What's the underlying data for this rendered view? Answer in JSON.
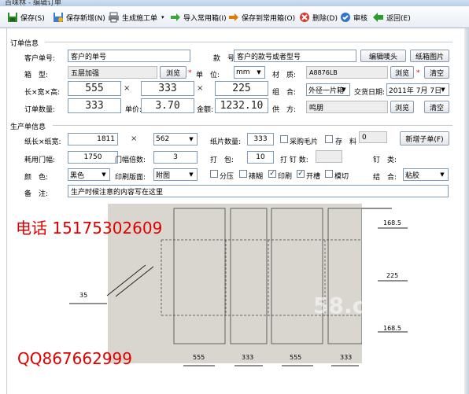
{
  "window": {
    "title": "百味林 - 编辑订单"
  },
  "toolbar": {
    "save": "保存(S)",
    "save_new": "保存新增(N)",
    "gen_work": "生成施工单",
    "import": "导入常用箱(I)",
    "save_common": "保存到常用箱(O)",
    "delete": "删除(D)",
    "audit": "审核",
    "back": "返回(E)"
  },
  "order": {
    "section": "订单信息",
    "cust_no_label": "客户单号:",
    "cust_no_value": "客户的单号",
    "style_label": "款　号:",
    "style_value": "客户的款号或者型号",
    "edit_head_btn": "编辑唛头",
    "carton_img_btn": "纸箱图片",
    "box_label": "箱　型:",
    "box_value": "五层加强",
    "browse1": "浏览",
    "unit_label": "单　位:",
    "unit_value": "mm",
    "material_label": "材　质:",
    "material_value": "A8876LB",
    "browse2": "浏览",
    "clear1": "清空",
    "dims_label": "长×宽×高:",
    "length": "555",
    "width": "333",
    "height": "225",
    "times": "×",
    "combo_label": "组　合:",
    "combo_value": "外径一片箱",
    "delivery_label": "交货日期:",
    "delivery_value": "2011年 7月 7日",
    "qty_label": "订单数量:",
    "qty_value": "333",
    "price_label": "单价:",
    "price_value": "3.70",
    "amount_label": "金额:",
    "amount_value": "1232.10",
    "supplier_label": "供　方:",
    "supplier_value": "鸣朋",
    "browse3": "浏览",
    "clear2": "清空",
    "star": "*"
  },
  "production": {
    "section": "生产单信息",
    "paper_label": "纸长×纸宽:",
    "paper_len": "1811",
    "paper_wid": "562",
    "sheets_label": "纸片数量:",
    "sheets_value": "333",
    "purchase_label": "采购毛片",
    "stock_label": "存　料",
    "stock_value": "0",
    "new_job_btn": "新增子单(F)",
    "door_label": "耗用门幅:",
    "door_value": "1750",
    "door_mult_label": "门幅倍数:",
    "door_mult_value": "3",
    "pack_label": "打　包:",
    "pack_value": "10",
    "nail_count_label": "打 钉 数:",
    "nail_label": "钉　类:",
    "color_label": "颜　色:",
    "color_value": "黑色",
    "print_label": "印刷版面:",
    "print_value": "附图",
    "opt_split": "分压",
    "opt_glue": "裱糊",
    "opt_print": "印刷",
    "opt_slot": "开槽",
    "opt_die": "模切",
    "join_label": "结　合:",
    "join_value": "粘胶",
    "note_label": "备　注:",
    "note_value": "生产时候注意的内容写在这里"
  },
  "overlay": {
    "phone": "电话 15175302609",
    "qq": "QQ867662999",
    "watermark": "58.com"
  },
  "drawing": {
    "left_flap": "35",
    "right_top": "168.5",
    "right_mid": "225",
    "right_bot": "168.5",
    "bottom": [
      "555",
      "333",
      "555",
      "333"
    ]
  }
}
